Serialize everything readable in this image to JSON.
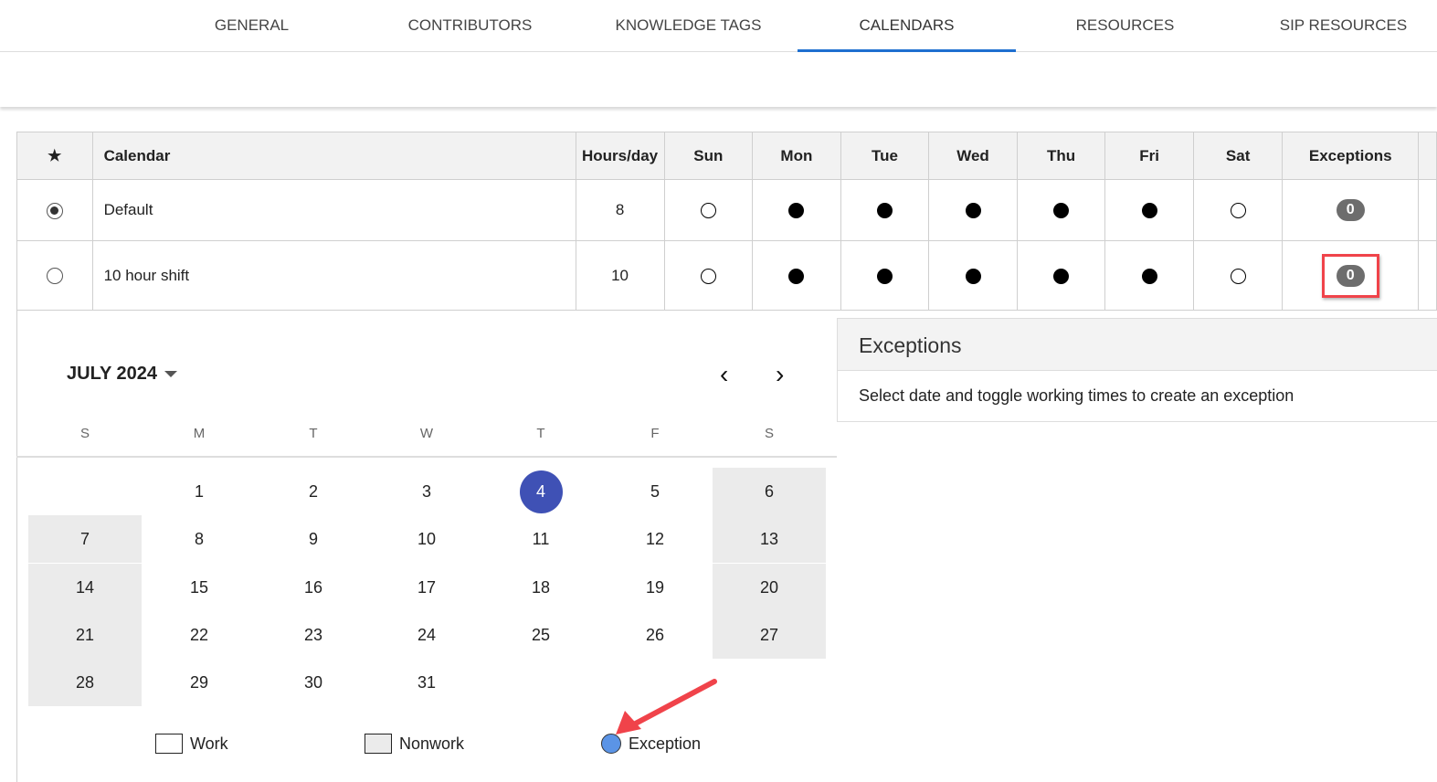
{
  "tabs": [
    "GENERAL",
    "CONTRIBUTORS",
    "KNOWLEDGE TAGS",
    "CALENDARS",
    "RESOURCES",
    "SIP RESOURCES"
  ],
  "active_tab": 3,
  "table": {
    "headers": {
      "calendar": "Calendar",
      "hours": "Hours/day",
      "days": [
        "Sun",
        "Mon",
        "Tue",
        "Wed",
        "Thu",
        "Fri",
        "Sat"
      ],
      "exceptions": "Exceptions"
    },
    "rows": [
      {
        "name": "Default",
        "hours": "8",
        "selected": true,
        "workdays": [
          false,
          true,
          true,
          true,
          true,
          true,
          false
        ],
        "exceptions": "0"
      },
      {
        "name": "10 hour shift",
        "hours": "10",
        "selected": false,
        "workdays": [
          false,
          true,
          true,
          true,
          true,
          true,
          false
        ],
        "exceptions": "0"
      }
    ]
  },
  "calendar": {
    "month_label": "JULY 2024",
    "day_headers": [
      "S",
      "M",
      "T",
      "W",
      "T",
      "F",
      "S"
    ],
    "first_weekday": 1,
    "days_in_month": 31,
    "today": 4,
    "legend": {
      "work": "Work",
      "nonwork": "Nonwork",
      "exception": "Exception"
    }
  },
  "exceptions_panel": {
    "title": "Exceptions",
    "text": "Select date and toggle working times to create an exception"
  },
  "colors": {
    "accent": "#1e6fd0",
    "today": "#3f51b5",
    "exception": "#5b94e6",
    "highlight": "#f0434a"
  }
}
